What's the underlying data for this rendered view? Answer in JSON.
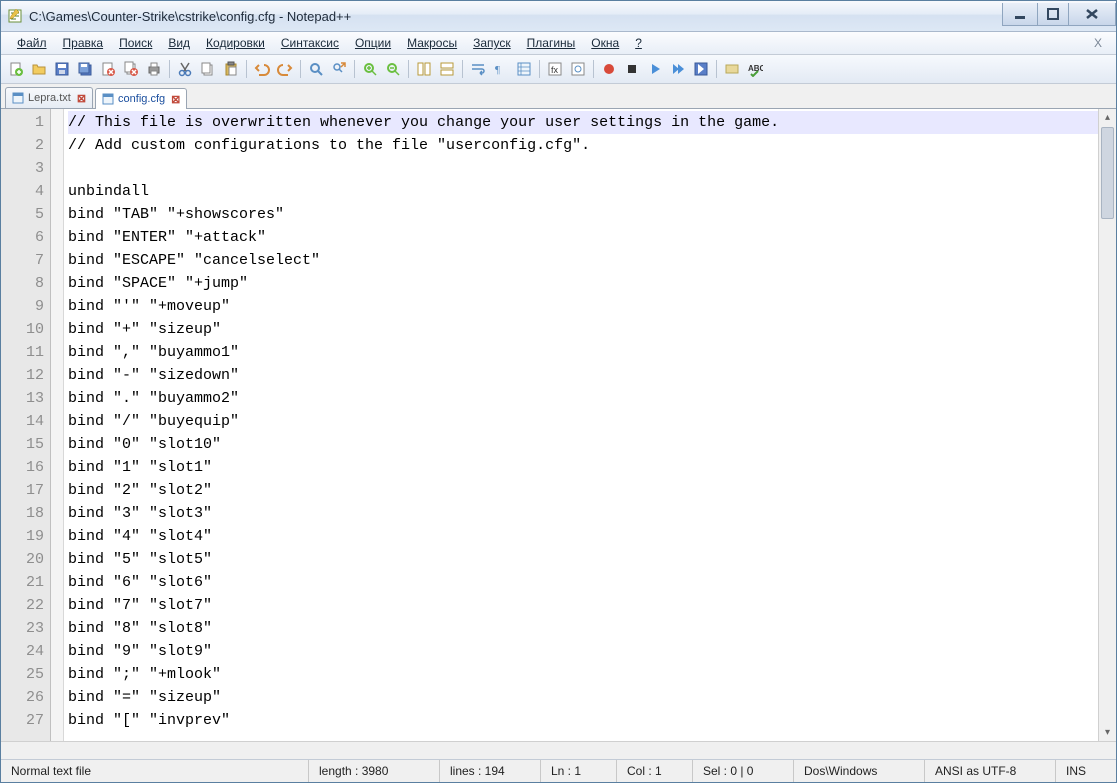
{
  "window": {
    "title": "C:\\Games\\Counter-Strike\\cstrike\\config.cfg - Notepad++"
  },
  "menu": {
    "items": [
      "Файл",
      "Правка",
      "Поиск",
      "Вид",
      "Кодировки",
      "Синтаксис",
      "Опции",
      "Макросы",
      "Запуск",
      "Плагины",
      "Окна",
      "?"
    ]
  },
  "toolbar_icons": [
    "new-file-icon",
    "open-file-icon",
    "save-icon",
    "save-all-icon",
    "close-icon",
    "close-all-icon",
    "print-icon",
    "sep",
    "cut-icon",
    "copy-icon",
    "paste-icon",
    "sep",
    "undo-icon",
    "redo-icon",
    "sep",
    "find-icon",
    "replace-icon",
    "sep",
    "zoom-in-icon",
    "zoom-out-icon",
    "sep",
    "sync-v-icon",
    "sync-h-icon",
    "sep",
    "wrap-icon",
    "all-chars-icon",
    "indent-guide-icon",
    "sep",
    "lang-icon",
    "doc-map-icon",
    "sep",
    "record-icon",
    "stop-icon",
    "play-icon",
    "play-multi-icon",
    "save-macro-icon",
    "sep",
    "toggle-icon",
    "spell-icon"
  ],
  "tabs": [
    {
      "label": "Lepra.txt",
      "active": false
    },
    {
      "label": "config.cfg",
      "active": true
    }
  ],
  "code_lines": [
    "// This file is overwritten whenever you change your user settings in the game.",
    "// Add custom configurations to the file \"userconfig.cfg\".",
    "",
    "unbindall",
    "bind \"TAB\" \"+showscores\"",
    "bind \"ENTER\" \"+attack\"",
    "bind \"ESCAPE\" \"cancelselect\"",
    "bind \"SPACE\" \"+jump\"",
    "bind \"'\" \"+moveup\"",
    "bind \"+\" \"sizeup\"",
    "bind \",\" \"buyammo1\"",
    "bind \"-\" \"sizedown\"",
    "bind \".\" \"buyammo2\"",
    "bind \"/\" \"buyequip\"",
    "bind \"0\" \"slot10\"",
    "bind \"1\" \"slot1\"",
    "bind \"2\" \"slot2\"",
    "bind \"3\" \"slot3\"",
    "bind \"4\" \"slot4\"",
    "bind \"5\" \"slot5\"",
    "bind \"6\" \"slot6\"",
    "bind \"7\" \"slot7\"",
    "bind \"8\" \"slot8\"",
    "bind \"9\" \"slot9\"",
    "bind \";\" \"+mlook\"",
    "bind \"=\" \"sizeup\"",
    "bind \"[\" \"invprev\""
  ],
  "status": {
    "filetype": "Normal text file",
    "length": "length : 3980",
    "lines": "lines : 194",
    "ln": "Ln : 1",
    "col": "Col : 1",
    "sel": "Sel : 0 | 0",
    "eol": "Dos\\Windows",
    "encoding": "ANSI as UTF-8",
    "mode": "INS"
  }
}
